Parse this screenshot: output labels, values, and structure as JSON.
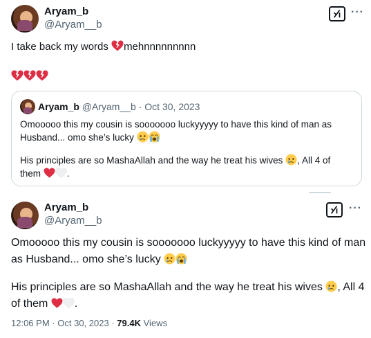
{
  "tweet": {
    "author_name": "Aryam_b",
    "author_handle": "@Aryam__b",
    "text": "I take back my words",
    "text_suffix": "mehnnnnnnnnn"
  },
  "quoted": {
    "author_name": "Aryam_b",
    "author_handle": "@Aryam__b",
    "separator": "·",
    "date": "Oct 30, 2023",
    "para1_line1": "Omooooo this my cousin is sooooooo luckyyyyy to have this kind of man as",
    "para1_line2": "Husband... omo she’s lucky",
    "para2_line1": "His principles are so MashaAllah and the way he treat his wives",
    "para2_line1_end": ", All 4 of",
    "para2_line2": "them"
  },
  "detail": {
    "author_name": "Aryam_b",
    "author_handle": "@Aryam__b",
    "para1_line1": "Omooooo this my cousin is sooooooo luckyyyyy to have this kind of man",
    "para1_line2": "as Husband... omo she’s lucky",
    "para2_line1": "His principles are so MashaAllah and the way he treat his wives",
    "para2_line1_end": ", All 4",
    "para2_line2": "of them",
    "time": "12:06 PM",
    "separator": "·",
    "date": "Oct 30, 2023",
    "separator2": "·",
    "views_count": "79.4K",
    "views_label": "Views"
  },
  "icons": {
    "grok": "grok-icon",
    "more": "more-icon",
    "broken_heart": "broken-heart-icon",
    "crying_face": "crying-face-icon",
    "loudly_crying": "loudly-crying-face-icon",
    "red_heart": "red-heart-icon",
    "white_heart": "white-heart-icon"
  },
  "colors": {
    "text": "#0f1419",
    "secondary": "#536471",
    "border": "#cfd9de",
    "heart_red": "#dd2e44"
  }
}
